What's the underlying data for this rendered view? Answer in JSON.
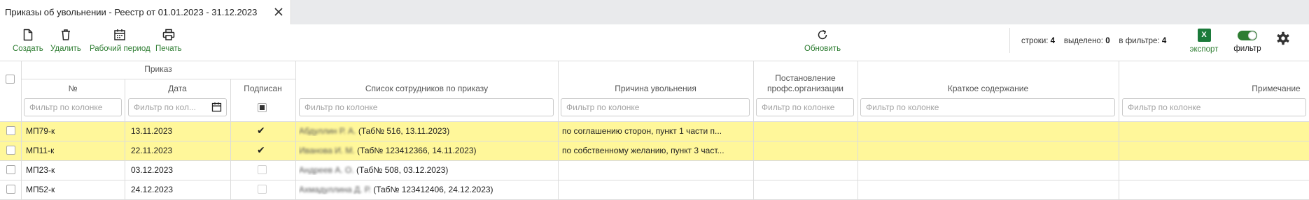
{
  "tab": {
    "title": "Приказы об увольнении - Реестр от 01.01.2023 - 31.12.2023"
  },
  "toolbar": {
    "create": "Создать",
    "delete": "Удалить",
    "period": "Рабочий период",
    "print": "Печать",
    "refresh": "Обновить",
    "export": "экспорт",
    "excel_letter": "X",
    "filter": "фильтр",
    "filter_on": true
  },
  "stats": {
    "rows_label": "строки:",
    "rows": "4",
    "selected_label": "выделено:",
    "selected": "0",
    "infilter_label": "в фильтре:",
    "infilter": "4"
  },
  "grid": {
    "group_header": "Приказ",
    "columns": {
      "num": "№",
      "date": "Дата",
      "signed": "Подписан",
      "employees": "Список сотрудников по приказу",
      "reason": "Причина увольнения",
      "union_line1": "Постановление",
      "union_line2": "профс.организации",
      "summary": "Краткое содержание",
      "note": "Примечание"
    },
    "filter_placeholder": "Фильтр по колонке",
    "filter_date_placeholder": "Фильтр по кол...",
    "rows": [
      {
        "num": "МП79-к",
        "date": "13.11.2023",
        "signed": true,
        "emp_name": "Абдуллин Р. А.",
        "emp_rest": " (Таб№ 516, 13.11.2023)",
        "reason": "по соглашению сторон, пункт 1 части п...",
        "highlight": true
      },
      {
        "num": "МП11-к",
        "date": "22.11.2023",
        "signed": true,
        "emp_name": "Иванова И. М.",
        "emp_rest": " (Таб№ 123412366, 14.11.2023)",
        "reason": "по собственному желанию, пункт 3 част...",
        "highlight": true
      },
      {
        "num": "МП23-к",
        "date": "03.12.2023",
        "signed": false,
        "emp_name": "Андреев А. О.",
        "emp_rest": " (Таб№ 508, 03.12.2023)",
        "reason": "",
        "highlight": false
      },
      {
        "num": "МП52-к",
        "date": "24.12.2023",
        "signed": false,
        "emp_name": "Ахмадуллина Д. Р.",
        "emp_rest": " (Таб№ 123412406, 24.12.2023)",
        "reason": "",
        "highlight": false
      }
    ]
  },
  "colors": {
    "accent": "#2e7d32",
    "highlight": "#fff79a",
    "tabbar": "#e9eaec"
  }
}
